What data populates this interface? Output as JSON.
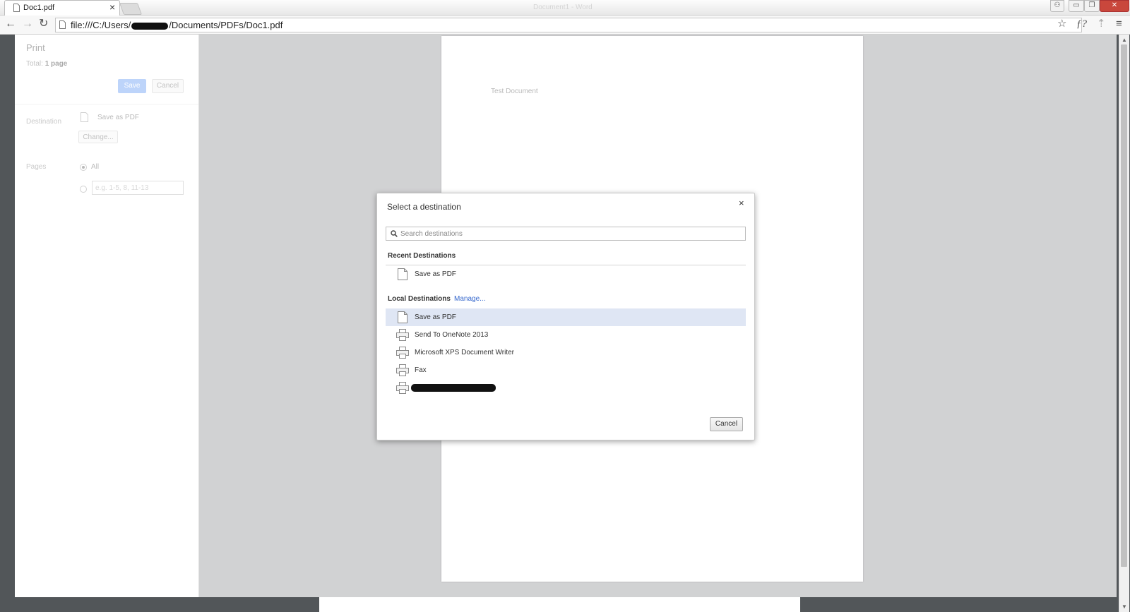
{
  "browser": {
    "tab_title": "Doc1.pdf",
    "tab_close": "×",
    "window_title": "Document1 - Word",
    "win_controls": {
      "user": "⚇",
      "minimize": "▭",
      "restore": "❐",
      "close": "✕"
    },
    "url_prefix": "file:///C:/Users/",
    "url_suffix": "/Documents/PDFs/Doc1.pdf",
    "icons": [
      "back-icon",
      "forward-icon",
      "reload-icon",
      "page-icon",
      "star-icon",
      "formula-extension-icon",
      "extension-icon",
      "menu-icon"
    ],
    "toolbar_glyphs": {
      "back": "←",
      "forward": "→",
      "reload": "↻",
      "star": "☆",
      "formula": "ƒ?",
      "ext": "⇡",
      "menu": "≡"
    }
  },
  "print": {
    "title": "Print",
    "total_prefix": "Total: ",
    "total_value": "1 page",
    "save_label": "Save",
    "cancel_label": "Cancel",
    "destination_label": "Destination",
    "destination_value": "Save as PDF",
    "change_label": "Change...",
    "pages_label": "Pages",
    "pages_all": "All",
    "pages_range_placeholder": "e.g. 1-5, 8, 11-13"
  },
  "preview": {
    "page_text": "Test Document"
  },
  "dialog": {
    "title": "Select a destination",
    "close": "×",
    "search_placeholder": "Search destinations",
    "recent_heading": "Recent Destinations",
    "recent": [
      {
        "label": "Save as PDF",
        "icon": "document-icon"
      }
    ],
    "local_heading": "Local Destinations",
    "manage_label": "Manage...",
    "local": [
      {
        "label": "Save as PDF",
        "icon": "document-icon",
        "selected": true
      },
      {
        "label": "Send To OneNote 2013",
        "icon": "printer-icon"
      },
      {
        "label": "Microsoft XPS Document Writer",
        "icon": "printer-icon"
      },
      {
        "label": "Fax",
        "icon": "printer-icon"
      },
      {
        "label": "",
        "icon": "printer-icon",
        "redacted": true
      }
    ],
    "cancel_label": "Cancel"
  },
  "colors": {
    "accent": "#3366cc",
    "selected_row": "#dfe6f4",
    "save_button": "#6fa1f4",
    "preview_bg": "#d1d2d3",
    "frame_bg": "#525659"
  }
}
